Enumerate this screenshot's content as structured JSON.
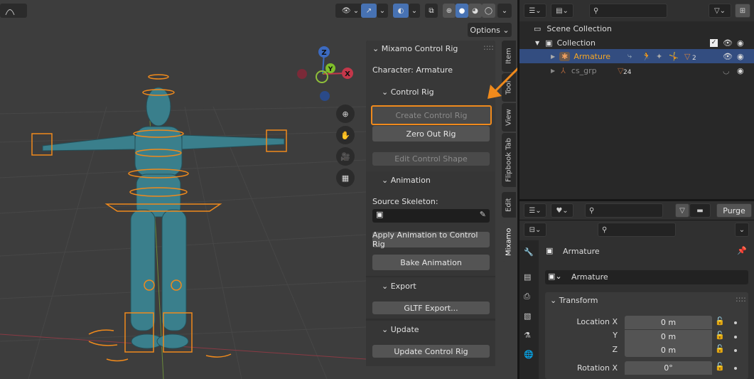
{
  "viewport": {
    "header": {
      "options_label": "Options",
      "view_icon": "curve-icon"
    },
    "gizmo": {
      "x": "X",
      "y": "Y",
      "z": "Z"
    },
    "sidebar": {
      "panel_title": "Mixamo Control Rig",
      "character_label": "Character: Armature",
      "control_rig_section": "Control Rig",
      "create_control_rig": "Create Control Rig",
      "zero_out_rig": "Zero Out Rig",
      "edit_control_shape": "Edit Control Shape",
      "animation_section": "Animation",
      "source_skeleton_label": "Source Skeleton:",
      "source_skeleton_value": "",
      "apply_animation": "Apply Animation to Control Rig",
      "bake_animation": "Bake Animation",
      "export_section": "Export",
      "gltf_export": "GLTF Export...",
      "update_section": "Update",
      "update_control_rig": "Update Control Rig"
    },
    "tabs": [
      "Item",
      "Tool",
      "View",
      "Flipbook Tab",
      "Edit",
      "Mixamo"
    ],
    "active_tab": "Mixamo",
    "highlight_color": "#f08a1c"
  },
  "outliner": {
    "search_placeholder": "",
    "items": [
      {
        "label": "Scene Collection"
      },
      {
        "label": "Collection"
      },
      {
        "label": "Armature",
        "badge": "2"
      },
      {
        "label": "cs_grp",
        "badge": "24"
      }
    ]
  },
  "blend_file": {
    "purge_label": "Purge",
    "search_placeholder": ""
  },
  "properties": {
    "object_name": "Armature",
    "datablock_name": "Armature",
    "transform_title": "Transform",
    "fields": [
      {
        "label": "Location X",
        "value": "0 m"
      },
      {
        "label": "Y",
        "value": "0 m"
      },
      {
        "label": "Z",
        "value": "0 m"
      },
      {
        "label": "Rotation X",
        "value": "0°"
      }
    ]
  }
}
